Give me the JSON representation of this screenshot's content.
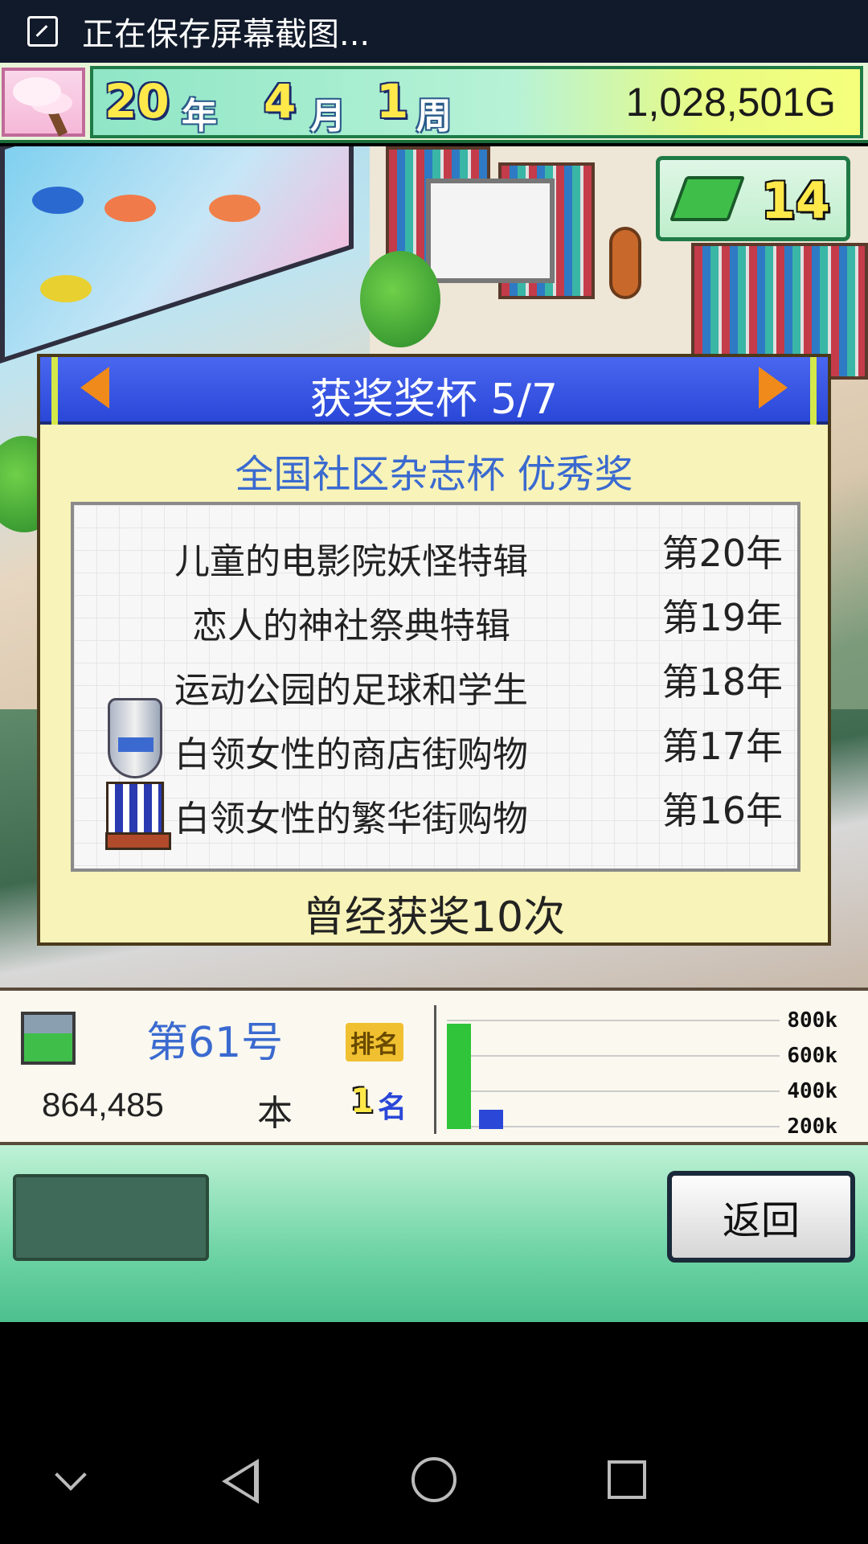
{
  "status_bar": {
    "text": "正在保存屏幕截图..."
  },
  "hud": {
    "year": "20",
    "year_unit": "年",
    "month": "4",
    "month_unit": "月",
    "week": "1",
    "week_unit": "周",
    "money": "1,028,501G"
  },
  "book_badge": {
    "count": "14",
    "icon": "book-icon"
  },
  "award_panel": {
    "title": "获奖奖杯 5/7",
    "award_name": "全国社区杂志杯 优秀奖",
    "entries": [
      {
        "name": "儿童的电影院妖怪特辑",
        "year": "第20年"
      },
      {
        "name": "恋人的神社祭典特辑",
        "year": "第19年"
      },
      {
        "name": "运动公园的足球和学生",
        "year": "第18年"
      },
      {
        "name": "白领女性的商店街购物",
        "year": "第17年"
      },
      {
        "name": "白领女性的繁华街购物",
        "year": "第16年"
      }
    ],
    "won_count": "曾经获奖10次",
    "arrow_color": "#f08a1a",
    "header_color": "#2a47d8"
  },
  "stats": {
    "issue": "第61号",
    "rank_label": "排名",
    "sales": "864,485",
    "sales_unit": "本",
    "rank_value": "1",
    "rank_unit": "名"
  },
  "chart_data": {
    "type": "bar",
    "ticks": [
      "800k",
      "600k",
      "400k",
      "200k"
    ],
    "series": [
      {
        "values": [
          864485
        ],
        "color": "#2fc43a"
      },
      {
        "values": [
          160000
        ],
        "color": "#2a47d8"
      }
    ],
    "ylim": [
      0,
      900000
    ]
  },
  "actions": {
    "back_label": "返回"
  }
}
